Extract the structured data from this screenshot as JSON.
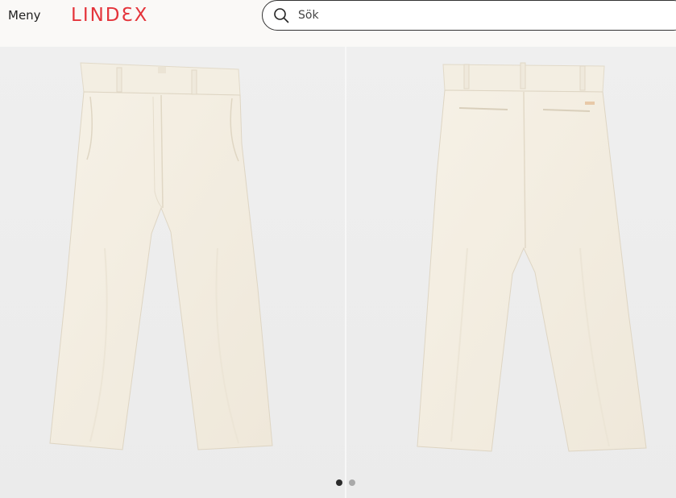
{
  "header": {
    "menu_label": "Meny",
    "logo_text": "LINDƐX",
    "search": {
      "placeholder": "Sök",
      "value": ""
    }
  },
  "gallery": {
    "images": [
      {
        "view": "front",
        "icon": "pants-front-image"
      },
      {
        "view": "back",
        "icon": "pants-back-image"
      }
    ],
    "dots": {
      "count": 2,
      "active_index": 0
    }
  },
  "colors": {
    "brand": "#e4343b",
    "header_bg": "#faf9f7",
    "photo_bg": "#ececec",
    "garment": "#f4efe3",
    "dot_active": "#2b2b2b",
    "dot_inactive": "#a9a9a9"
  }
}
